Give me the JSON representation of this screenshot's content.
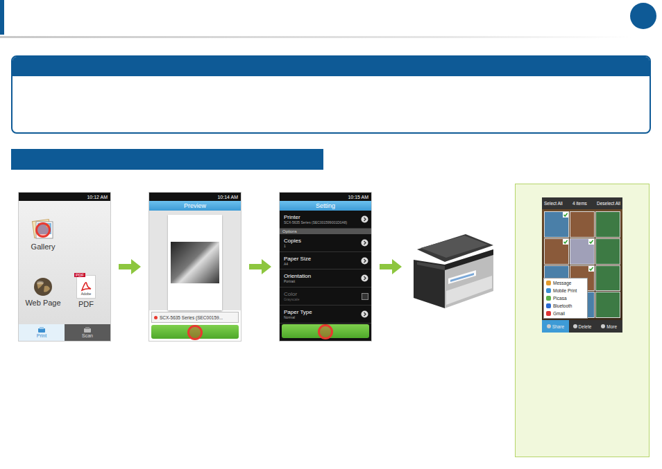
{
  "steps": [
    {
      "kind": "home",
      "status_time": "10:12 AM",
      "apps": [
        {
          "label": "Gallery",
          "icon": "gallery",
          "tapped": true
        },
        {
          "label": "Web Page",
          "icon": "globe",
          "tapped": false
        },
        {
          "label": "PDF",
          "icon": "pdf",
          "badge": "PDF",
          "sub": "Adobe",
          "tapped": false
        }
      ],
      "tabs": [
        {
          "label": "Print",
          "selected": true
        },
        {
          "label": "Scan",
          "selected": false
        }
      ]
    },
    {
      "kind": "preview",
      "status_time": "10:14 AM",
      "title": "Preview",
      "printer": "SCX-5635 Series (SEC00159...",
      "button_tapped": true
    },
    {
      "kind": "setting",
      "status_time": "10:15 AM",
      "title": "Setting",
      "rows": [
        {
          "kind": "arrow",
          "label": "Printer",
          "value": "SCX-5635 Series (SEC001599001D0A8)",
          "disabled": false
        },
        {
          "kind": "section",
          "label": "Options"
        },
        {
          "kind": "arrow",
          "label": "Copies",
          "value": "1",
          "disabled": false
        },
        {
          "kind": "arrow",
          "label": "Paper Size",
          "value": "A4",
          "disabled": false
        },
        {
          "kind": "arrow",
          "label": "Orientation",
          "value": "Portrait",
          "disabled": false
        },
        {
          "kind": "checkbox",
          "label": "Color",
          "value": "Grayscale",
          "checked": false,
          "disabled": true
        },
        {
          "kind": "arrow",
          "label": "Paper Type",
          "value": "Normal",
          "disabled": false
        }
      ],
      "button_tapped": true
    },
    {
      "kind": "printer"
    }
  ],
  "note": {
    "select_all": "Select All",
    "count": "4 items",
    "deselect_all": "Deselect All",
    "thumbs": [
      {
        "checked": true
      },
      {
        "checked": false
      },
      {
        "checked": false
      },
      {
        "checked": true
      },
      {
        "checked": true
      },
      {
        "checked": false
      },
      {
        "checked": false
      },
      {
        "checked": true
      },
      {
        "checked": false
      },
      {
        "checked": false
      },
      {
        "checked": false
      },
      {
        "checked": false
      }
    ],
    "menu": [
      "Message",
      "Mobile Print",
      "Picasa",
      "Bluetooth",
      "Gmail"
    ],
    "toolbar": [
      {
        "label": "Share",
        "selected": true
      },
      {
        "label": "Delete",
        "selected": false
      },
      {
        "label": "More",
        "selected": false
      }
    ]
  }
}
